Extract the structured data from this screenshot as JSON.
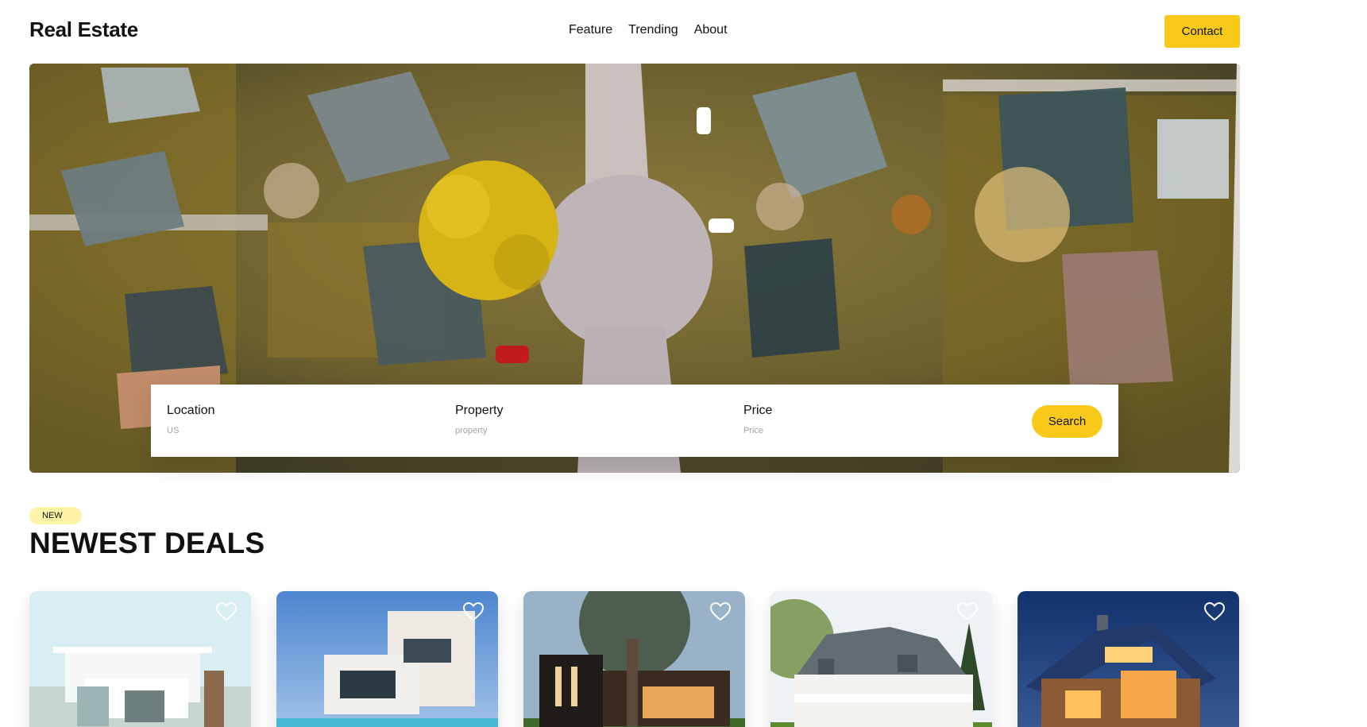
{
  "header": {
    "logo": "Real Estate",
    "nav": [
      "Feature",
      "Trending",
      "About"
    ],
    "contact_label": "Contact"
  },
  "search": {
    "location_label": "Location",
    "location_placeholder": "US",
    "property_label": "Property",
    "property_placeholder": "property",
    "price_label": "Price",
    "price_placeholder": "Price",
    "button_label": "Search"
  },
  "section": {
    "badge": "NEW",
    "title": "NEWEST DEALS"
  },
  "cards": [
    {
      "icon": "heart-icon"
    },
    {
      "icon": "heart-icon"
    },
    {
      "icon": "heart-icon"
    },
    {
      "icon": "heart-icon"
    },
    {
      "icon": "heart-icon"
    }
  ],
  "colors": {
    "accent": "#f8c918",
    "badge_bg": "#fff3a8",
    "text": "#111111"
  }
}
